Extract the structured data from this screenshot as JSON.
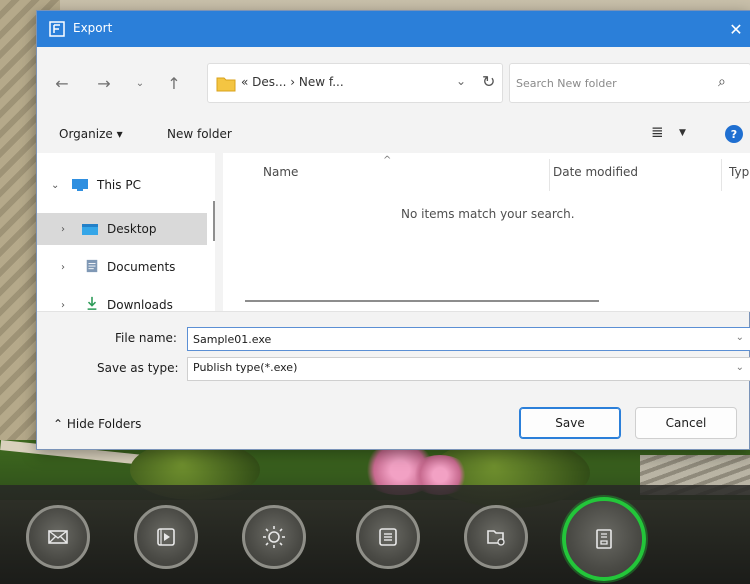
{
  "dialog": {
    "title": "Export",
    "close_icon": "close-icon",
    "colors": {
      "titlebar": "#2b7fd9",
      "body": "#f3f3f3",
      "accent": "#1f6fd1",
      "active_tool": "#23c63a"
    }
  },
  "nav": {
    "back_icon": "arrow-left-icon",
    "forward_icon": "arrow-right-icon",
    "recent_icon": "chevron-down-icon",
    "up_icon": "arrow-up-icon",
    "address_text": "« Des... › New f...",
    "refresh_icon": "refresh-icon",
    "search_placeholder": "Search New folder",
    "search_icon": "search-icon"
  },
  "commands": {
    "organize": "Organize ▾",
    "new_folder": "New folder",
    "view_icon": "list-view-icon",
    "help": "?"
  },
  "sidebar": {
    "items": [
      {
        "label": "This PC",
        "icon": "computer-icon",
        "chevron": "⌄",
        "selected": false
      },
      {
        "label": "Desktop",
        "icon": "desktop-folder-icon",
        "chevron": "›",
        "selected": true
      },
      {
        "label": "Documents",
        "icon": "document-icon",
        "chevron": "›",
        "selected": false
      },
      {
        "label": "Downloads",
        "icon": "download-icon",
        "chevron": "›",
        "selected": false
      }
    ]
  },
  "files": {
    "columns": [
      "Name",
      "Date modified",
      "Typ"
    ],
    "empty_message": "No items match your search."
  },
  "form": {
    "file_name_label": "File name:",
    "file_name_value": "Sample01.exe",
    "save_type_label": "Save as type:",
    "save_type_value": "Publish type(*.exe)"
  },
  "footer": {
    "hide_folders": "Hide Folders",
    "save": "Save",
    "cancel": "Cancel"
  },
  "toolbar": {
    "buttons": [
      {
        "icon": "mail-icon",
        "active": false
      },
      {
        "icon": "video-icon",
        "active": false
      },
      {
        "icon": "sun-icon",
        "active": false
      },
      {
        "icon": "list-icon",
        "active": false
      },
      {
        "icon": "folder-settings-icon",
        "active": false
      },
      {
        "icon": "export-file-icon",
        "active": true
      }
    ]
  }
}
